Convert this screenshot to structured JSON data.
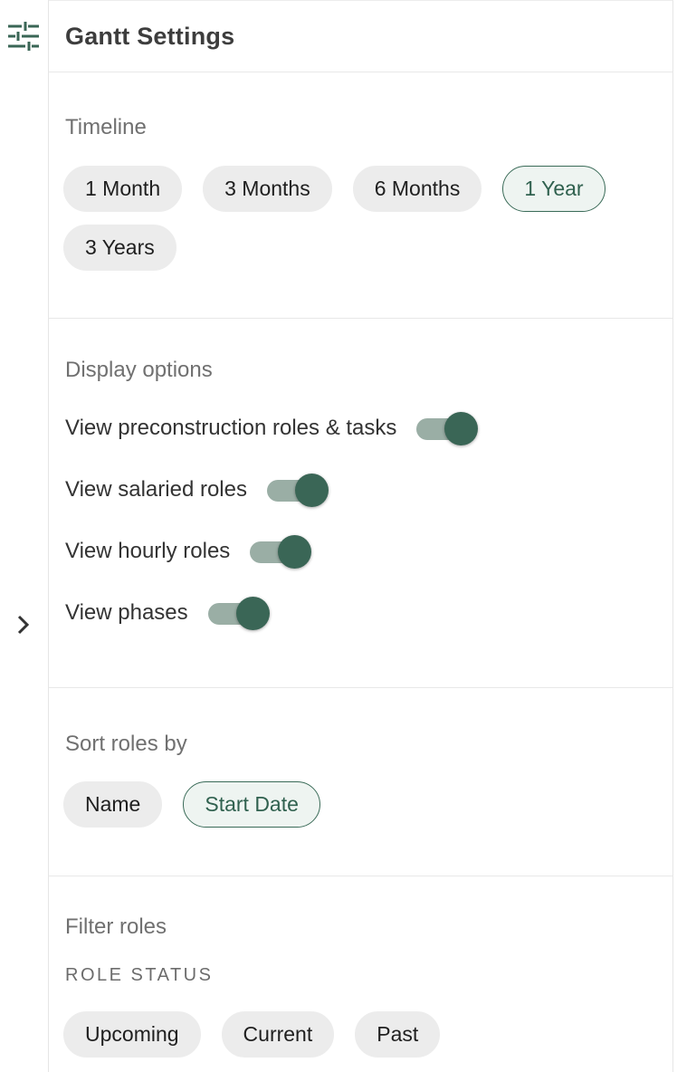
{
  "panel": {
    "title": "Gantt Settings"
  },
  "timeline": {
    "title": "Timeline",
    "options": [
      "1 Month",
      "3 Months",
      "6 Months",
      "1 Year",
      "3 Years"
    ],
    "selected": "1 Year"
  },
  "display": {
    "title": "Display options",
    "toggles": [
      {
        "label": "View preconstruction roles & tasks",
        "on": true
      },
      {
        "label": "View salaried roles",
        "on": true
      },
      {
        "label": "View hourly roles",
        "on": true
      },
      {
        "label": "View phases",
        "on": true
      }
    ]
  },
  "sort": {
    "title": "Sort roles by",
    "options": [
      "Name",
      "Start Date"
    ],
    "selected": "Start Date"
  },
  "filter": {
    "title": "Filter roles",
    "status_label": "ROLE STATUS",
    "options": [
      "Upcoming",
      "Current",
      "Past"
    ]
  },
  "icons": {
    "settings": "tune-sliders-icon",
    "expand": "chevron-right-icon"
  },
  "colors": {
    "accent": "#3a6656",
    "track": "#9aaea5",
    "chip": "#ececec",
    "selected_bg": "#eef4f1"
  }
}
